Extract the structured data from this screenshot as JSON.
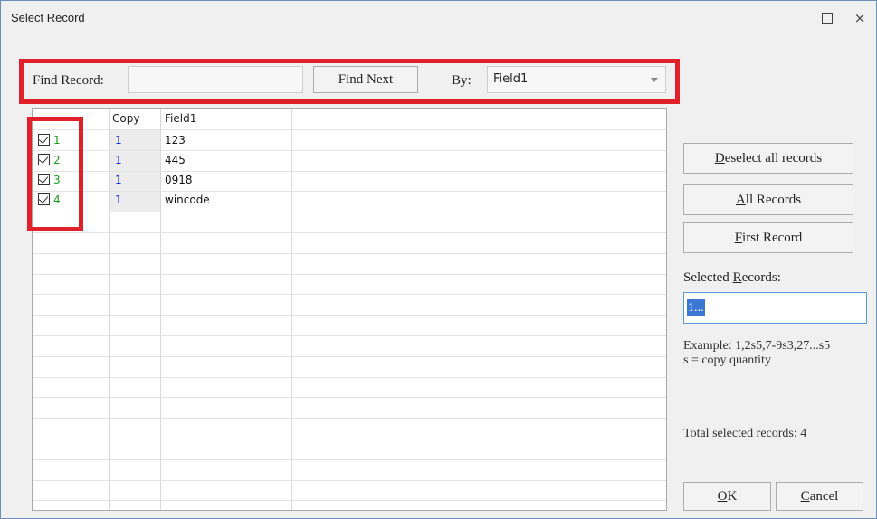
{
  "dialog": {
    "title": "Select Record",
    "maximize_glyph": "□",
    "close_glyph": "×"
  },
  "find": {
    "label": "Find Record:",
    "value": "",
    "find_next": "Find Next",
    "by_label": "By:",
    "by_value": "Field1"
  },
  "table": {
    "headers": [
      "Copy",
      "Field1"
    ],
    "rows": [
      {
        "num": "1",
        "checked": true,
        "copy": "1",
        "field1": "123"
      },
      {
        "num": "2",
        "checked": true,
        "copy": "1",
        "field1": "445"
      },
      {
        "num": "3",
        "checked": true,
        "copy": "1",
        "field1": "0918"
      },
      {
        "num": "4",
        "checked": true,
        "copy": "1",
        "field1": "wincode"
      }
    ]
  },
  "actions": {
    "deselect_all": {
      "first": "D",
      "rest": "eselect all records"
    },
    "all_records": {
      "first": "A",
      "rest": "ll Records"
    },
    "first_record": {
      "first": "F",
      "rest": "irst Record"
    }
  },
  "selected": {
    "label_pre": "Selected ",
    "label_u": "R",
    "label_post": "ecords:",
    "value": "1..."
  },
  "example": {
    "line1": "Example: 1,2s5,7-9s3,27...s5",
    "line2": "s = copy quantity"
  },
  "total": "Total selected records: 4",
  "buttons": {
    "ok": {
      "first": "O",
      "rest": "K"
    },
    "cancel": {
      "first": "C",
      "rest": "ancel"
    }
  },
  "colors": {
    "highlight": "#e0202a",
    "number_green": "#1a9a1a",
    "copy_blue": "#1b2fd6",
    "selection": "#3a78d4"
  }
}
